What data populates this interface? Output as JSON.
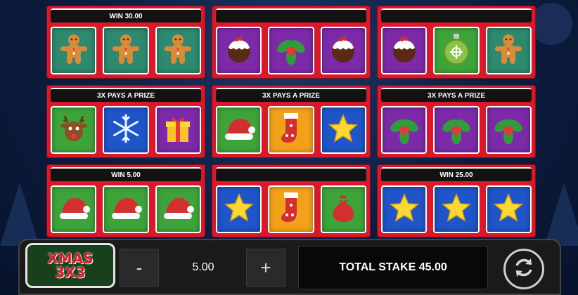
{
  "game": {
    "logo_line1": "XMAS",
    "logo_line2": "3X3"
  },
  "cards": [
    {
      "banner": "WIN 30.00",
      "symbols": [
        {
          "icon": "gingerbread-icon",
          "bg": "teal"
        },
        {
          "icon": "gingerbread-icon",
          "bg": "teal"
        },
        {
          "icon": "gingerbread-icon",
          "bg": "teal"
        }
      ]
    },
    {
      "banner": "",
      "symbols": [
        {
          "icon": "pudding-icon",
          "bg": "purple"
        },
        {
          "icon": "holly-icon",
          "bg": "purple"
        },
        {
          "icon": "pudding-icon",
          "bg": "purple"
        }
      ]
    },
    {
      "banner": "",
      "symbols": [
        {
          "icon": "pudding-icon",
          "bg": "purple"
        },
        {
          "icon": "bauble-icon",
          "bg": "green"
        },
        {
          "icon": "gingerbread-icon",
          "bg": "teal"
        }
      ]
    },
    {
      "banner": "3X PAYS A PRIZE",
      "symbols": [
        {
          "icon": "reindeer-icon",
          "bg": "green"
        },
        {
          "icon": "snowflake-icon",
          "bg": "blue"
        },
        {
          "icon": "gift-icon",
          "bg": "purple"
        }
      ]
    },
    {
      "banner": "3X PAYS A PRIZE",
      "symbols": [
        {
          "icon": "santa-hat-icon",
          "bg": "green"
        },
        {
          "icon": "stocking-icon",
          "bg": "orange"
        },
        {
          "icon": "star-icon",
          "bg": "blue"
        }
      ]
    },
    {
      "banner": "3X PAYS A PRIZE",
      "symbols": [
        {
          "icon": "holly-icon",
          "bg": "purple"
        },
        {
          "icon": "holly-icon",
          "bg": "purple"
        },
        {
          "icon": "holly-icon",
          "bg": "purple"
        }
      ]
    },
    {
      "banner": "WIN 5.00",
      "symbols": [
        {
          "icon": "santa-hat-icon",
          "bg": "green"
        },
        {
          "icon": "santa-hat-icon",
          "bg": "green"
        },
        {
          "icon": "santa-hat-icon",
          "bg": "green"
        }
      ]
    },
    {
      "banner": "",
      "symbols": [
        {
          "icon": "star-icon",
          "bg": "blue"
        },
        {
          "icon": "stocking-icon",
          "bg": "orange"
        },
        {
          "icon": "sack-icon",
          "bg": "green"
        }
      ]
    },
    {
      "banner": "WIN 25.00",
      "symbols": [
        {
          "icon": "star-icon",
          "bg": "blue"
        },
        {
          "icon": "star-icon",
          "bg": "blue"
        },
        {
          "icon": "star-icon",
          "bg": "blue"
        }
      ]
    }
  ],
  "controls": {
    "minus_label": "-",
    "stake_value": "5.00",
    "plus_label": "+",
    "total_stake": "TOTAL STAKE 45.00",
    "spin_icon": "refresh-icon"
  },
  "colors": {
    "card_red": "#d9182a",
    "teal": "#2d8a6f",
    "purple": "#7d2aa8",
    "green": "#3ea43a",
    "blue": "#1f55c8",
    "orange": "#f2a21a"
  }
}
